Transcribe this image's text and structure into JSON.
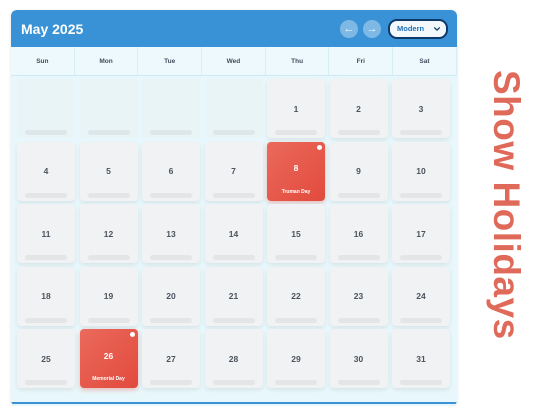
{
  "header": {
    "month_title": "May 2025",
    "prev_icon": "arrow-left-icon",
    "next_icon": "arrow-right-icon",
    "theme_value": "Modern"
  },
  "weekdays": [
    "Sun",
    "Mon",
    "Tue",
    "Wed",
    "Thu",
    "Fri",
    "Sat"
  ],
  "days": [
    {
      "day": "",
      "col": 0,
      "row": 0
    },
    {
      "day": "",
      "col": 1,
      "row": 0
    },
    {
      "day": "",
      "col": 2,
      "row": 0
    },
    {
      "day": "",
      "col": 3,
      "row": 0
    },
    {
      "day": "1",
      "col": 4,
      "row": 0
    },
    {
      "day": "2",
      "col": 5,
      "row": 0
    },
    {
      "day": "3",
      "col": 6,
      "row": 0
    },
    {
      "day": "4",
      "col": 0,
      "row": 1
    },
    {
      "day": "5",
      "col": 1,
      "row": 1
    },
    {
      "day": "6",
      "col": 2,
      "row": 1
    },
    {
      "day": "7",
      "col": 3,
      "row": 1
    },
    {
      "day": "8",
      "col": 4,
      "row": 1,
      "holiday": "Truman Day"
    },
    {
      "day": "9",
      "col": 5,
      "row": 1
    },
    {
      "day": "10",
      "col": 6,
      "row": 1
    },
    {
      "day": "11",
      "col": 0,
      "row": 2
    },
    {
      "day": "12",
      "col": 1,
      "row": 2
    },
    {
      "day": "13",
      "col": 2,
      "row": 2
    },
    {
      "day": "14",
      "col": 3,
      "row": 2
    },
    {
      "day": "15",
      "col": 4,
      "row": 2
    },
    {
      "day": "16",
      "col": 5,
      "row": 2
    },
    {
      "day": "17",
      "col": 6,
      "row": 2
    },
    {
      "day": "18",
      "col": 0,
      "row": 3
    },
    {
      "day": "19",
      "col": 1,
      "row": 3
    },
    {
      "day": "20",
      "col": 2,
      "row": 3
    },
    {
      "day": "21",
      "col": 3,
      "row": 3
    },
    {
      "day": "22",
      "col": 4,
      "row": 3
    },
    {
      "day": "23",
      "col": 5,
      "row": 3
    },
    {
      "day": "24",
      "col": 6,
      "row": 3
    },
    {
      "day": "25",
      "col": 0,
      "row": 4
    },
    {
      "day": "26",
      "col": 1,
      "row": 4,
      "holiday": "Memorial Day"
    },
    {
      "day": "27",
      "col": 2,
      "row": 4
    },
    {
      "day": "28",
      "col": 3,
      "row": 4
    },
    {
      "day": "29",
      "col": 4,
      "row": 4
    },
    {
      "day": "30",
      "col": 5,
      "row": 4
    },
    {
      "day": "31",
      "col": 6,
      "row": 4
    }
  ],
  "colors": {
    "header": "#3a92d6",
    "holiday": "#e24a3d",
    "side_label": "#e06a5a"
  },
  "side_label": "Show Holidays"
}
